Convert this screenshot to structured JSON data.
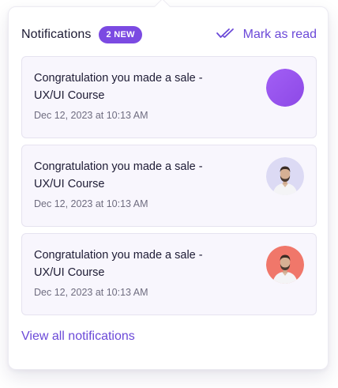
{
  "header": {
    "title": "Notifications",
    "badge": "2 NEW",
    "mark_read_label": "Mark as read",
    "mark_read_icon": "double-check-icon"
  },
  "notifications": [
    {
      "line1": "Congratulation you made a sale -",
      "line2": "UX/UI Course",
      "time": "Dec 12, 2023 at  10:13 AM",
      "avatar": "purple-gradient-circle"
    },
    {
      "line1": "Congratulation you made a sale -",
      "line2": "UX/UI Course",
      "time": "Dec 12, 2023 at  10:13 AM",
      "avatar": "man-photo-lavender-background"
    },
    {
      "line1": "Congratulation you made a sale -",
      "line2": "UX/UI Course",
      "time": "Dec 12, 2023 at  10:13 AM",
      "avatar": "man-photo-coral-background"
    }
  ],
  "footer": {
    "view_all_label": "View all notifications"
  },
  "colors": {
    "accent": "#6b49d8",
    "badge_bg": "#7b4ae2",
    "card_bg": "#f8f6fd",
    "avatar_lavender": "#dcdaf4",
    "avatar_coral": "#f0776a"
  }
}
